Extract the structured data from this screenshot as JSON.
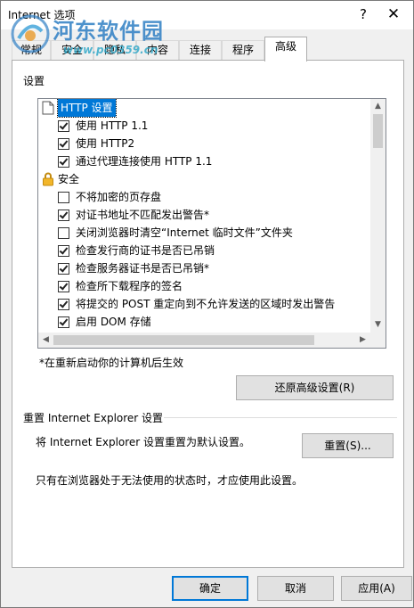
{
  "window": {
    "title": "Internet 选项",
    "help": "?",
    "close": "✕"
  },
  "watermark": {
    "title": "河东软件园",
    "url": "www.pc0359.cn"
  },
  "tabs": [
    {
      "label": "常规",
      "active": false
    },
    {
      "label": "安全",
      "active": false
    },
    {
      "label": "隐私",
      "active": false
    },
    {
      "label": "内容",
      "active": false
    },
    {
      "label": "连接",
      "active": false
    },
    {
      "label": "程序",
      "active": false
    },
    {
      "label": "高级",
      "active": true
    }
  ],
  "settings": {
    "group_label": "设置",
    "items": [
      {
        "type": "group",
        "label": "HTTP 设置",
        "icon": "page-icon",
        "selected": true
      },
      {
        "type": "check",
        "label": "使用 HTTP 1.1",
        "checked": true
      },
      {
        "type": "check",
        "label": "使用 HTTP2",
        "checked": true
      },
      {
        "type": "check",
        "label": "通过代理连接使用 HTTP 1.1",
        "checked": true
      },
      {
        "type": "group",
        "label": "安全",
        "icon": "lock-icon",
        "selected": false
      },
      {
        "type": "check",
        "label": "不将加密的页存盘",
        "checked": false
      },
      {
        "type": "check",
        "label": "对证书地址不匹配发出警告*",
        "checked": true
      },
      {
        "type": "check",
        "label": "关闭浏览器时清空“Internet 临时文件”文件夹",
        "checked": false
      },
      {
        "type": "check",
        "label": "检查发行商的证书是否已吊销",
        "checked": true
      },
      {
        "type": "check",
        "label": "检查服务器证书是否已吊销*",
        "checked": true
      },
      {
        "type": "check",
        "label": "检查所下载程序的签名",
        "checked": true
      },
      {
        "type": "check",
        "label": "将提交的 POST 重定向到不允许发送的区域时发出警告",
        "checked": true
      },
      {
        "type": "check",
        "label": "启用 DOM 存储",
        "checked": true
      }
    ],
    "restart_note": "*在重新启动你的计算机后生效",
    "restore_button": "还原高级设置(R)"
  },
  "reset": {
    "section_title": "重置 Internet Explorer 设置",
    "description": "将 Internet Explorer 设置重置为默认设置。",
    "button": "重置(S)...",
    "hint": "只有在浏览器处于无法使用的状态时，才应使用此设置。"
  },
  "footer": {
    "ok": "确定",
    "cancel": "取消",
    "apply": "应用(A)"
  },
  "colors": {
    "accent": "#0078d7",
    "watermark": "#2f7fc4"
  }
}
